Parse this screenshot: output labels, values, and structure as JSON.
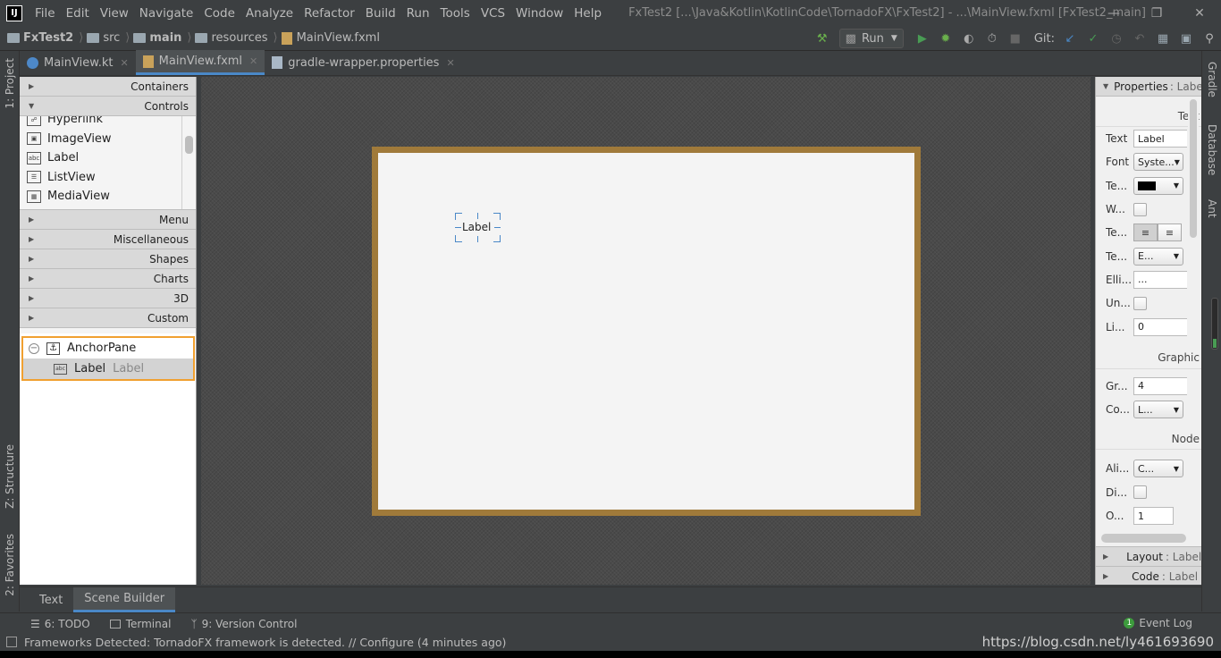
{
  "menubar": {
    "items": [
      "File",
      "Edit",
      "View",
      "Navigate",
      "Code",
      "Analyze",
      "Refactor",
      "Build",
      "Run",
      "Tools",
      "VCS",
      "Window",
      "Help"
    ],
    "window_title": "FxTest2 [...\\Java&Kotlin\\KotlinCode\\TornadoFX\\FxTest2] - ...\\MainView.fxml [FxTest2_main]"
  },
  "breadcrumb": [
    "FxTest2",
    "src",
    "main",
    "resources",
    "MainView.fxml"
  ],
  "toolbar": {
    "run_config": "Run",
    "git_label": "Git:"
  },
  "tabs": [
    {
      "label": "MainView.kt",
      "active": false
    },
    {
      "label": "MainView.fxml",
      "active": true
    },
    {
      "label": "gradle-wrapper.properties",
      "active": false
    }
  ],
  "left_strip": {
    "project": "1: Project",
    "structure": "Z: Structure",
    "favorites": "2: Favorites"
  },
  "right_strip": {
    "gradle": "Gradle",
    "database": "Database",
    "ant": "Ant"
  },
  "library": {
    "sections_top": [
      "Containers",
      "Controls"
    ],
    "controls": [
      "Hyperlink",
      "ImageView",
      "Label",
      "ListView",
      "MediaView"
    ],
    "sections_bottom": [
      "Menu",
      "Miscellaneous",
      "Shapes",
      "Charts",
      "3D",
      "Custom"
    ]
  },
  "hierarchy": {
    "root": "AnchorPane",
    "child": "Label",
    "child_text": "Label"
  },
  "canvas": {
    "label_text": "Label"
  },
  "inspector": {
    "title": "Properties",
    "title_sub": ": Label",
    "section_text": "Text",
    "section_graphic": "Graphic",
    "section_node": "Node",
    "rows": {
      "text": {
        "label": "Text",
        "value": "Label"
      },
      "font": {
        "label": "Font",
        "value": "Syste..."
      },
      "textfill": {
        "label": "Te..."
      },
      "wrap": {
        "label": "W..."
      },
      "textalign": {
        "label": "Te..."
      },
      "textoverrun": {
        "label": "Te...",
        "value": "E..."
      },
      "ellipsis": {
        "label": "Elli...",
        "value": "..."
      },
      "underline": {
        "label": "Un..."
      },
      "linespacing": {
        "label": "Li...",
        "value": "0"
      },
      "graphicgap": {
        "label": "Gr...",
        "value": "4"
      },
      "contentdisplay": {
        "label": "Co...",
        "value": "L..."
      },
      "alignment": {
        "label": "Ali...",
        "value": "C..."
      },
      "disable": {
        "label": "Di..."
      },
      "opacity": {
        "label": "O...",
        "value": "1"
      }
    },
    "layout": "Layout",
    "layout_sub": ": Label",
    "code": "Code",
    "code_sub": ": Label"
  },
  "editor_bottom_tabs": [
    "Text",
    "Scene Builder"
  ],
  "toolwindows": {
    "todo": "6: TODO",
    "terminal": "Terminal",
    "vcs": "9: Version Control",
    "event_log": "Event Log",
    "event_count": "1"
  },
  "status": {
    "message": "Frameworks Detected: TornadoFX framework is detected. // Configure (4 minutes ago)",
    "watermark": "https://blog.csdn.net/ly461693690"
  },
  "colors": {
    "accent": "#4a88c7",
    "selection_frame": "#f0a030",
    "anchorpane_border": "#a07a3a",
    "run_green": "#499c54"
  }
}
